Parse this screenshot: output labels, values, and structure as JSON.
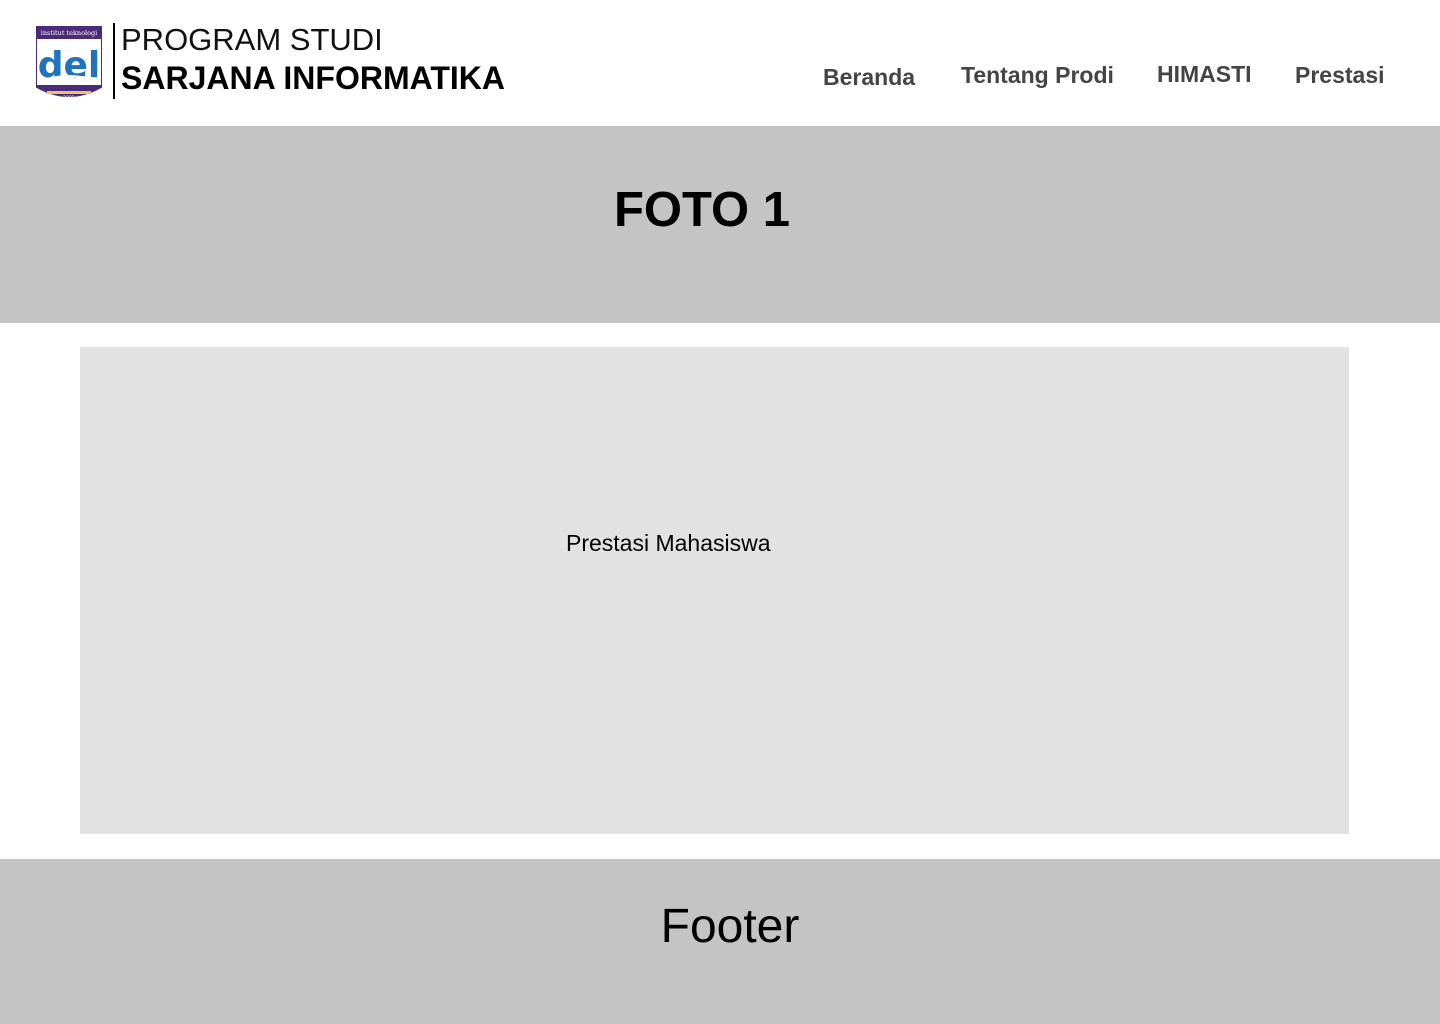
{
  "header": {
    "logo": {
      "name": "institut-teknologi-del-logo",
      "top_text": "institut teknologi",
      "word": "del",
      "bottom_text": "2001"
    },
    "brand_line1": "PROGRAM STUDI",
    "brand_line2": "SARJANA INFORMATIKA",
    "nav": [
      {
        "label": "Beranda"
      },
      {
        "label": "Tentang Prodi"
      },
      {
        "label": "HIMASTI"
      },
      {
        "label": "Prestasi"
      }
    ]
  },
  "hero": {
    "title": "FOTO 1"
  },
  "content": {
    "label": "Prestasi Mahasiswa"
  },
  "footer": {
    "title": "Footer"
  },
  "colors": {
    "header_bg": "#ffffff",
    "hero_bg": "#c4c4c4",
    "panel_bg": "#e2e2e2",
    "footer_bg": "#c4c4c4",
    "nav_text": "#444444",
    "logo_blue": "#1e73be",
    "logo_purple": "#4b2a7a"
  }
}
